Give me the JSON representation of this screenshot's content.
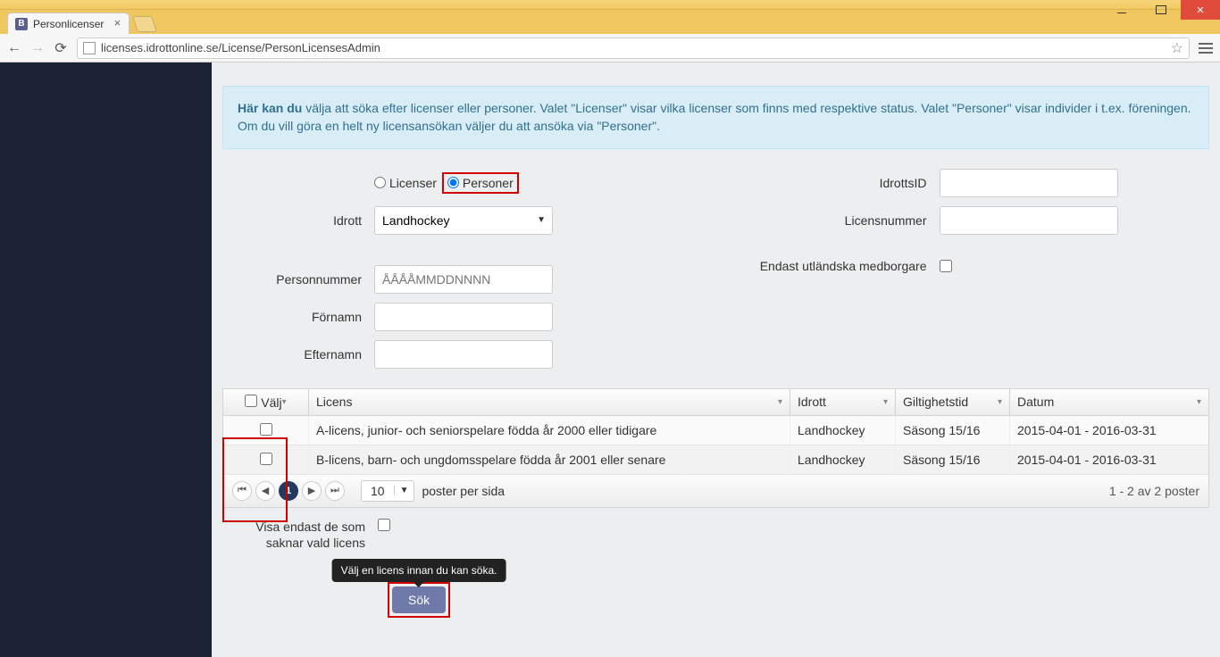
{
  "browser": {
    "tab_title": "Personlicenser",
    "tab_favicon_letter": "B",
    "url": "licenses.idrottonline.se/License/PersonLicensesAdmin"
  },
  "info_box": {
    "lead": "Här kan du",
    "rest": " välja att söka efter licenser eller personer. Valet \"Licenser\" visar vilka licenser som finns med respektive status. Valet \"Personer\" visar individer i t.ex. föreningen. Om du vill göra en helt ny licensansökan väljer du att ansöka via \"Personer\"."
  },
  "form": {
    "radio_licenser_label": "Licenser",
    "radio_personer_label": "Personer",
    "idrott_label": "Idrott",
    "idrott_value": "Landhockey",
    "personnummer_label": "Personnummer",
    "personnummer_placeholder": "ÅÅÅÅMMDDNNNN",
    "fornamn_label": "Förnamn",
    "efternamn_label": "Efternamn",
    "idrottsid_label": "IdrottsID",
    "licensnummer_label": "Licensnummer",
    "endast_utl_label": "Endast utländska medborgare"
  },
  "grid": {
    "headers": {
      "valj": "Välj",
      "licens": "Licens",
      "idrott": "Idrott",
      "giltighet": "Giltighetstid",
      "datum": "Datum"
    },
    "rows": [
      {
        "licens": "A-licens, junior- och seniorspelare födda år 2000 eller tidigare",
        "idrott": "Landhockey",
        "giltighet": "Säsong 15/16",
        "datum": "2015-04-01 - 2016-03-31"
      },
      {
        "licens": "B-licens, barn- och ungdomsspelare födda år 2001 eller senare",
        "idrott": "Landhockey",
        "giltighet": "Säsong 15/16",
        "datum": "2015-04-01 - 2016-03-31"
      }
    ],
    "page_current": "1",
    "page_size": "10",
    "per_page_label": "poster per sida",
    "count_label": "1 - 2 av 2 poster"
  },
  "missing_license": {
    "label": "Visa endast de som saknar vald licens"
  },
  "tooltip": "Välj en licens innan du kan söka.",
  "sok_label": "Sök"
}
